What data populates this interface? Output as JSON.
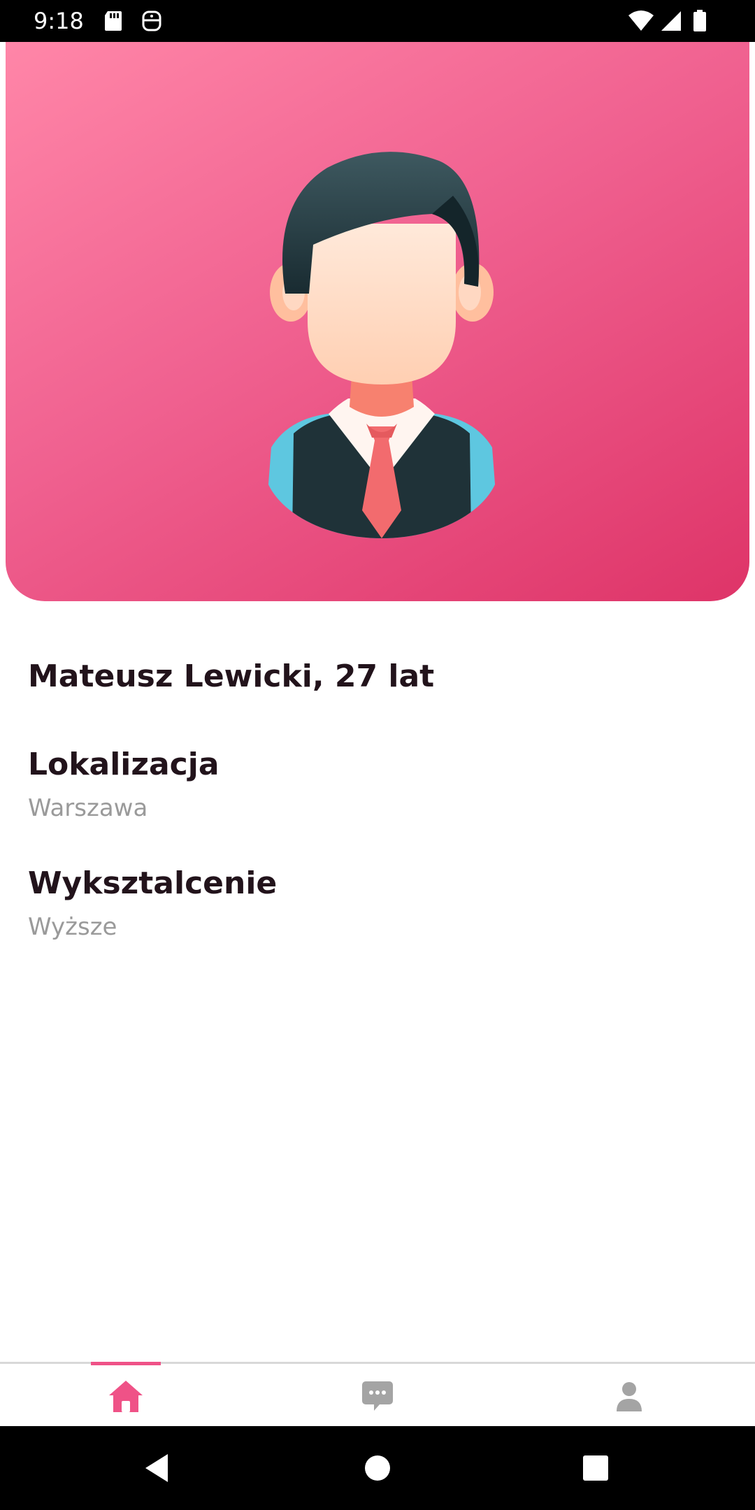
{
  "status_bar": {
    "time": "9:18",
    "icons": [
      "sd-card-icon",
      "sim-face-icon",
      "wifi-icon",
      "signal-icon",
      "battery-icon"
    ]
  },
  "profile": {
    "name_age": "Mateusz Lewicki, 27 lat",
    "sections": [
      {
        "title": "Lokalizacja",
        "value": "Warszawa"
      },
      {
        "title": "Wyksztalcenie",
        "value": "Wyższe"
      }
    ]
  },
  "bottom_nav": {
    "items": [
      {
        "icon": "home-icon",
        "active": true
      },
      {
        "icon": "chat-icon",
        "active": false
      },
      {
        "icon": "profile-icon",
        "active": false
      }
    ]
  },
  "colors": {
    "accent": "#ef5287",
    "banner_start": "#ff86a8",
    "banner_end": "#de3468",
    "heading": "#22131b",
    "muted": "#9a9a9a",
    "inactive_icon": "#a4a4a4"
  }
}
